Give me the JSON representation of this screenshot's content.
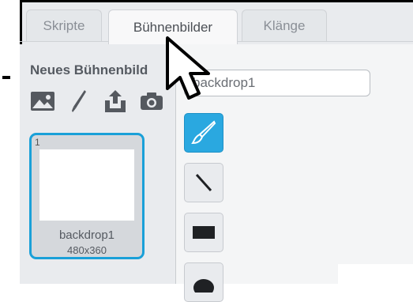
{
  "tabs": [
    {
      "label": "Skripte",
      "active": false
    },
    {
      "label": "Bühnenbilder",
      "active": true
    },
    {
      "label": "Klänge",
      "active": false
    }
  ],
  "left_panel": {
    "new_backdrop_label": "Neues Bühnenbild",
    "tool_icons": [
      "image-library-icon",
      "paint-brush-icon",
      "upload-icon",
      "camera-icon"
    ]
  },
  "backdrop": {
    "number": "1",
    "name": "backdrop1",
    "size": "480x360",
    "selected": true
  },
  "editor": {
    "name_field_value": "backdrop1",
    "tools": [
      "brush-tool",
      "line-tool",
      "rectangle-tool",
      "ellipse-tool"
    ],
    "active_tool": "brush-tool"
  },
  "colors": {
    "accent": "#1aa0d8",
    "active_tool": "#2aa8e0"
  }
}
